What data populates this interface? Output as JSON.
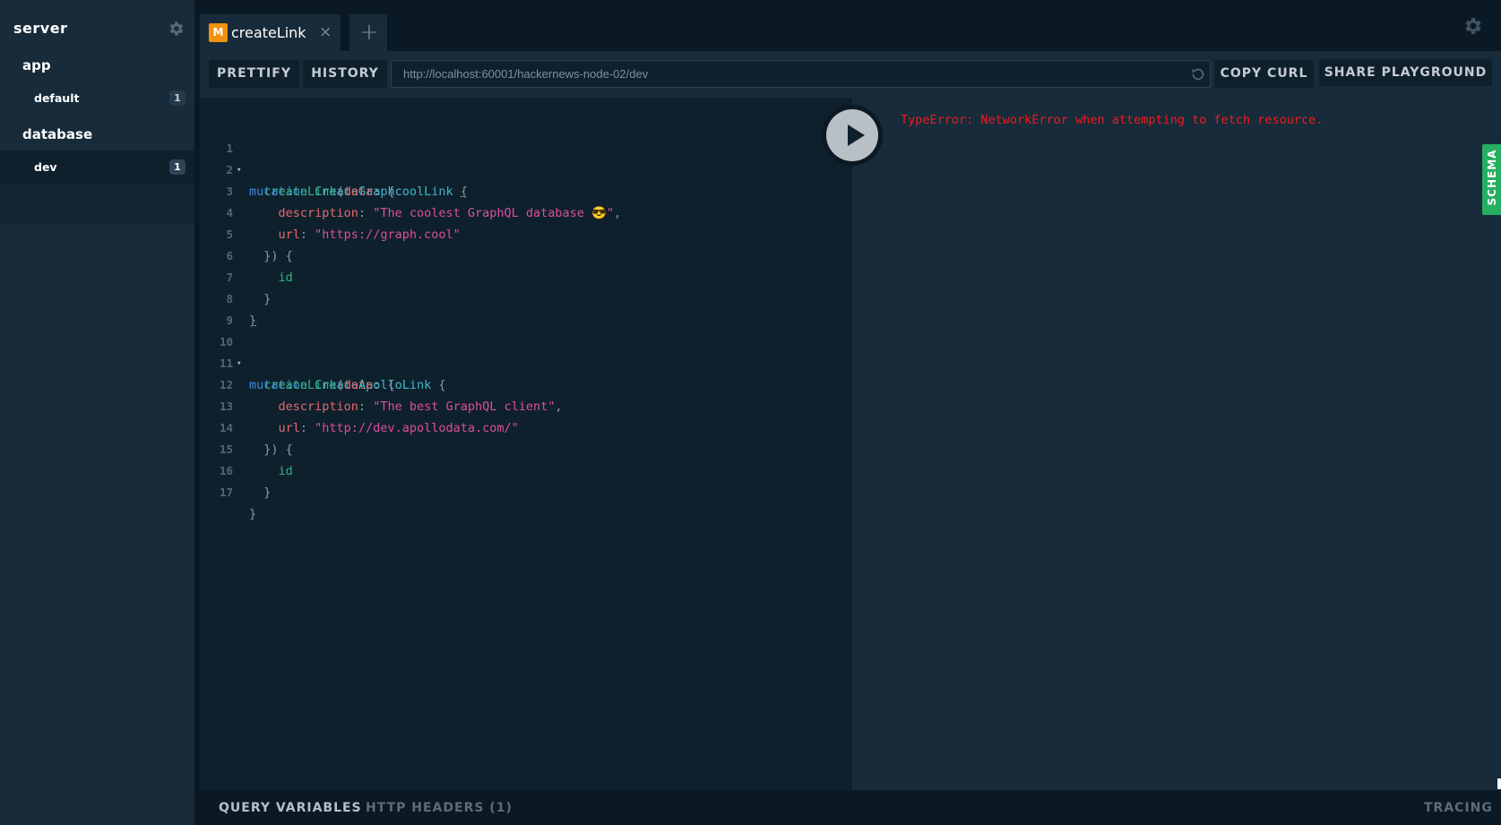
{
  "sidebar": {
    "project": "server",
    "groups": [
      {
        "name": "app",
        "items": [
          {
            "label": "default",
            "count": "1"
          }
        ]
      },
      {
        "name": "database",
        "items": [
          {
            "label": "dev",
            "count": "1"
          }
        ]
      }
    ],
    "icons": {
      "settings": "gear-icon"
    }
  },
  "tabs": [
    {
      "operation_badge": "M",
      "label": "createLink",
      "close": "×"
    }
  ],
  "tab_add": "+",
  "toolbar": {
    "prettify": "PRETTIFY",
    "history": "HISTORY",
    "url": "http://localhost:60001/hackernews-node-02/dev",
    "copy_curl": "COPY CURL",
    "share": "SHARE PLAYGROUND"
  },
  "editor": {
    "lines": [
      {
        "n": "1",
        "fold": "▾"
      },
      {
        "n": "2"
      },
      {
        "n": "3"
      },
      {
        "n": "4"
      },
      {
        "n": "5"
      },
      {
        "n": "6"
      },
      {
        "n": "7"
      },
      {
        "n": "8"
      },
      {
        "n": "9"
      },
      {
        "n": "10",
        "fold": "▾"
      },
      {
        "n": "11"
      },
      {
        "n": "12"
      },
      {
        "n": "13"
      },
      {
        "n": "14"
      },
      {
        "n": "15"
      },
      {
        "n": "16"
      },
      {
        "n": "17"
      }
    ],
    "tokens": {
      "mutation": "mutation",
      "op1": "CreateGraphcoolLink",
      "op2": "CreateApolloLink",
      "createLink": "createLink",
      "data": "data",
      "description": "description",
      "url": "url",
      "id": "id",
      "desc1": "\"The coolest GraphQL database 😎\"",
      "url1": "\"https://graph.cool\"",
      "desc2": "\"The best GraphQL client\"",
      "url2": "\"http://dev.apollodata.com/\""
    }
  },
  "result": {
    "error": "TypeError: NetworkError when attempting to fetch resource."
  },
  "schema_tab": "SCHEMA",
  "bottom": {
    "query_variables": "QUERY VARIABLES",
    "http_headers": "HTTP HEADERS (1)",
    "tracing": "TRACING"
  },
  "colors": {
    "accent_mutation": "#f2920c",
    "schema_green": "#27ae60",
    "error_red": "#f21b1b"
  }
}
